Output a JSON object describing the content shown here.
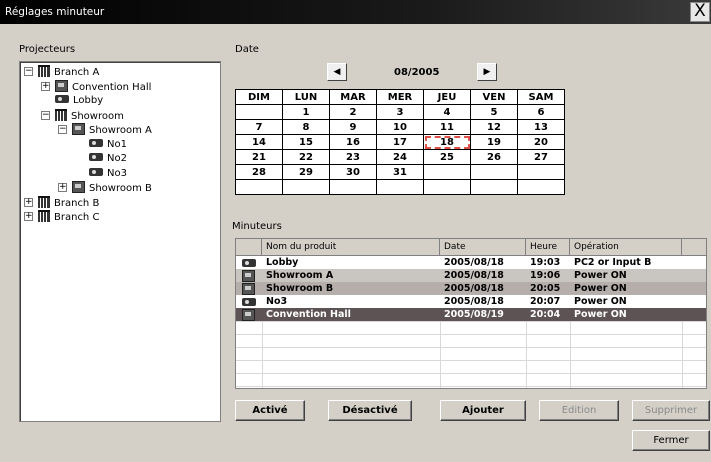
{
  "window": {
    "title": "Réglages minuteur",
    "close_label": "X"
  },
  "projectors_label": "Projecteurs",
  "tree": [
    {
      "label": "Branch A",
      "type": "building",
      "level": 0,
      "expander": "−"
    },
    {
      "label": "Convention Hall",
      "type": "room",
      "level": 1,
      "expander": "+"
    },
    {
      "label": "Lobby",
      "type": "projector",
      "level": 1,
      "expander": ""
    },
    {
      "label": "Showroom",
      "type": "building",
      "level": 1,
      "expander": "−"
    },
    {
      "label": "Showroom A",
      "type": "room",
      "level": 2,
      "expander": "−"
    },
    {
      "label": "No1",
      "type": "projector",
      "level": 3,
      "expander": ""
    },
    {
      "label": "No2",
      "type": "projector",
      "level": 3,
      "expander": ""
    },
    {
      "label": "No3",
      "type": "projector",
      "level": 3,
      "expander": ""
    },
    {
      "label": "Showroom B",
      "type": "room",
      "level": 2,
      "expander": "+"
    },
    {
      "label": "Branch B",
      "type": "building",
      "level": 0,
      "expander": "+"
    },
    {
      "label": "Branch C",
      "type": "building",
      "level": 0,
      "expander": "+"
    }
  ],
  "date_label": "Date",
  "calendar": {
    "month": "08/2005",
    "prev_label": "◀",
    "next_label": "▶",
    "days": [
      "DIM",
      "LUN",
      "MAR",
      "MER",
      "JEU",
      "VEN",
      "SAM"
    ],
    "weeks": [
      [
        "",
        "1",
        "2",
        "3",
        "4",
        "5",
        "6"
      ],
      [
        "7",
        "8",
        "9",
        "10",
        "11",
        "12",
        "13"
      ],
      [
        "14",
        "15",
        "16",
        "17",
        "18",
        "19",
        "20"
      ],
      [
        "21",
        "22",
        "23",
        "24",
        "25",
        "26",
        "27"
      ],
      [
        "28",
        "29",
        "30",
        "31",
        "",
        "",
        ""
      ],
      [
        "",
        "",
        "",
        "",
        "",
        "",
        ""
      ]
    ],
    "selected_day": "18"
  },
  "timers_label": "Minuteurs",
  "timers": {
    "columns": [
      "Nom du produit",
      "Date",
      "Heure",
      "Opération"
    ],
    "rows": [
      {
        "type": "projector",
        "name": "Lobby",
        "date": "2005/08/18",
        "time": "19:03",
        "operation": "PC2 or Input B",
        "style": "normal"
      },
      {
        "type": "room",
        "name": "Showroom A",
        "date": "2005/08/18",
        "time": "19:06",
        "operation": "Power ON",
        "style": "alt"
      },
      {
        "type": "room",
        "name": "Showroom B",
        "date": "2005/08/18",
        "time": "20:05",
        "operation": "Power ON",
        "style": "mid"
      },
      {
        "type": "projector",
        "name": "No3",
        "date": "2005/08/18",
        "time": "20:07",
        "operation": "Power ON",
        "style": "normal"
      },
      {
        "type": "room",
        "name": "Convention Hall",
        "date": "2005/08/19",
        "time": "20:04",
        "operation": "Power ON",
        "style": "selected"
      }
    ]
  },
  "buttons": {
    "activate": "Activé",
    "deactivate": "Désactivé",
    "add": "Ajouter",
    "edit": "Edition",
    "delete": "Supprimer",
    "close": "Fermer"
  }
}
